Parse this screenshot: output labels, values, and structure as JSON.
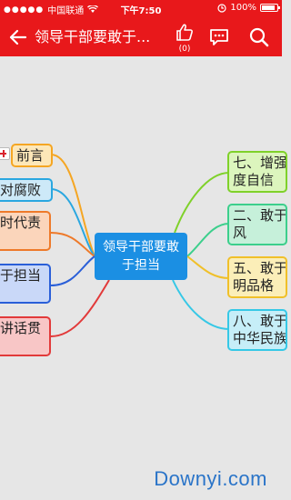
{
  "status_bar": {
    "carrier": "中国联通",
    "time": "下午7:50",
    "battery": "100%"
  },
  "app_bar": {
    "title": "领导干部要敢于...",
    "like_count": "(0)"
  },
  "mindmap": {
    "root": {
      "line1": "领导干部要敢",
      "line2": "于担当"
    },
    "left_nodes": [
      {
        "label": "前言",
        "color": "#f5a623",
        "fill": "#fde7b8"
      },
      {
        "label": "对腐败",
        "color": "#2aa7e0",
        "fill": "#cde9f8"
      },
      {
        "label": "时代责",
        "color": "#ee7a2a",
        "fill": "#fbd5bb"
      },
      {
        "label": "于担当",
        "color": "#2a5fd8",
        "fill": "#c9d8f8"
      },
      {
        "label": "讲话贯",
        "color": "#e23a3a",
        "fill": "#f8c6c6"
      }
    ],
    "right_nodes": [
      {
        "line1": "七、增强",
        "line2": "度自信",
        "color": "#7fd12a",
        "fill": "#dcf5bd"
      },
      {
        "line1": "二、敢于",
        "line2": "风",
        "color": "#3ccf8c",
        "fill": "#c6f0da"
      },
      {
        "line1": "五、敢于",
        "line2": "明品格",
        "color": "#f0c02a",
        "fill": "#fbeeb8"
      },
      {
        "line1": "八、敢于",
        "line2": "中华民族",
        "color": "#36c8e6",
        "fill": "#c6eef8"
      }
    ]
  },
  "watermark": "Downyi.com",
  "colors": {
    "brand": "#e8181b",
    "root": "#1b8fe3",
    "canvas": "#e6e6e6"
  }
}
